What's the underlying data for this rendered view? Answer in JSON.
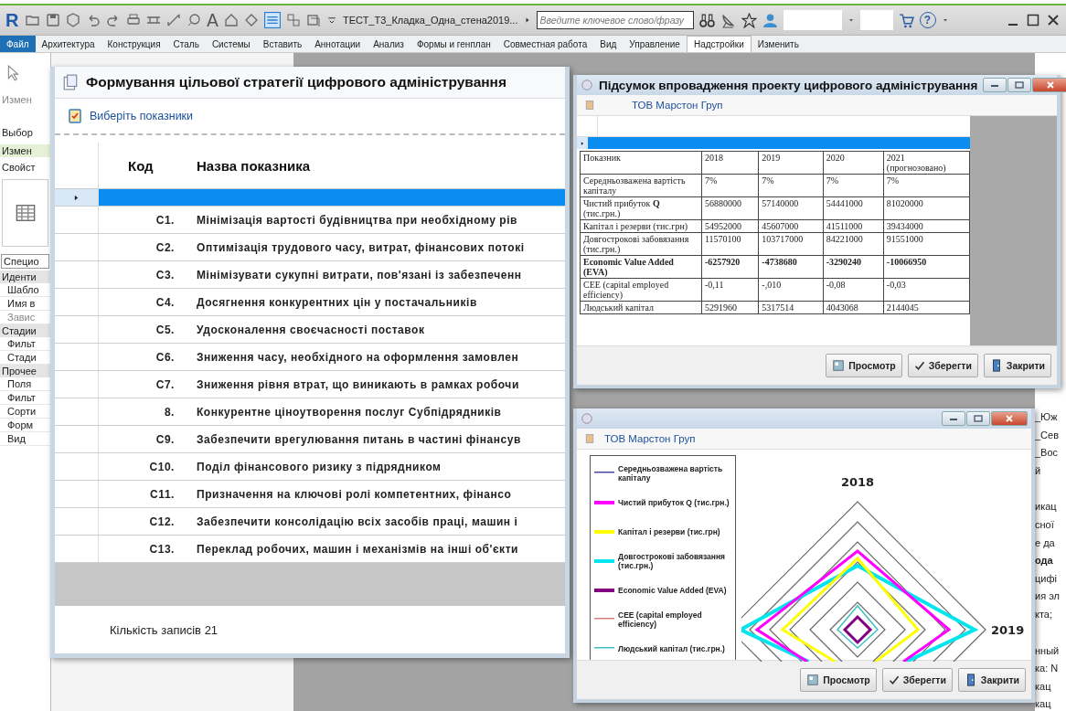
{
  "app": {
    "logo": "R",
    "text_tool": "A",
    "document_title": "ТЕСТ_Т3_Кладка_Одна_стена2019...",
    "search": {
      "placeholder": "Введите ключевое слово/фразу"
    },
    "help": "?"
  },
  "ribbon_tabs": [
    {
      "label": "Файл",
      "kind": "app_menu",
      "selected": false
    },
    {
      "label": "Архитектура",
      "kind": "tab",
      "selected": false
    },
    {
      "label": "Конструкция",
      "kind": "tab",
      "selected": false
    },
    {
      "label": "Сталь",
      "kind": "tab",
      "selected": false
    },
    {
      "label": "Системы",
      "kind": "tab",
      "selected": false
    },
    {
      "label": "Вставить",
      "kind": "tab",
      "selected": false
    },
    {
      "label": "Аннотации",
      "kind": "tab",
      "selected": false
    },
    {
      "label": "Анализ",
      "kind": "tab",
      "selected": false
    },
    {
      "label": "Формы и генплан",
      "kind": "tab",
      "selected": false
    },
    {
      "label": "Совместная работа",
      "kind": "tab",
      "selected": false
    },
    {
      "label": "Вид",
      "kind": "tab",
      "selected": false
    },
    {
      "label": "Управление",
      "kind": "tab",
      "selected": false
    },
    {
      "label": "Надстройки",
      "kind": "tab",
      "selected": true
    },
    {
      "label": "Изменить",
      "kind": "tab",
      "selected": false
    }
  ],
  "left_panel": {
    "modify_label": "Измен",
    "select_label": "Выбор",
    "context_label": "Измен",
    "properties_label": "Свойст",
    "type_selector": "Специо",
    "groups": [
      {
        "title": "Иденти",
        "params": [
          {
            "label": "Шабло",
            "disabled": false
          },
          {
            "label": "Имя в",
            "disabled": false
          },
          {
            "label": "Завис",
            "disabled": true
          }
        ]
      },
      {
        "title": "Стадии",
        "params": [
          {
            "label": "Фильт",
            "disabled": false
          },
          {
            "label": "Стади",
            "disabled": false
          }
        ]
      },
      {
        "title": "Прочее",
        "params": [
          {
            "label": "Поля",
            "disabled": false
          },
          {
            "label": "Фильт",
            "disabled": false
          },
          {
            "label": "Сорти",
            "disabled": false
          },
          {
            "label": "Форм",
            "disabled": false
          },
          {
            "label": "Вид",
            "disabled": false
          }
        ]
      }
    ]
  },
  "right_panel_fragments": [
    {
      "lines": [
        {
          "text": "_Юж",
          "bold": false
        },
        {
          "text": "_Сев",
          "bold": false
        },
        {
          "text": "_Вос",
          "bold": false
        },
        {
          "text": "й",
          "bold": false
        }
      ]
    },
    {
      "lines": [
        {
          "text": "икац",
          "bold": false
        },
        {
          "text": "сної",
          "bold": false
        },
        {
          "text": "е да",
          "bold": false
        },
        {
          "text": "ода",
          "bold": true
        },
        {
          "text": "цифі",
          "bold": false
        },
        {
          "text": "ия эл",
          "bold": false
        },
        {
          "text": "кта;",
          "bold": false
        }
      ]
    },
    {
      "lines": [
        {
          "text": "нный",
          "bold": false
        },
        {
          "text": "ка: N",
          "bold": false
        },
        {
          "text": "кац",
          "bold": false
        },
        {
          "text": "кац",
          "bold": false
        }
      ]
    }
  ],
  "strategy_window": {
    "title": "Формування цільової стратегії цифрового адміністрування",
    "toolbar_button": "Виберіть показники",
    "columns": [
      "Код",
      "Назва показника"
    ],
    "rows": [
      {
        "selected": true
      },
      {
        "code": "C1.",
        "name": "Мінімізація вартості будівництва при необхідному рів",
        "selected": false
      },
      {
        "code": "C2.",
        "name": "Оптимізація трудового часу, витрат, фінансових потокі",
        "selected": false
      },
      {
        "code": "C3.",
        "name": "Мінімізувати сукупні витрати, пов'язані із забезпеченн",
        "selected": false
      },
      {
        "code": "C4.",
        "name": "Досягнення конкурентних цін у постачальників",
        "selected": false
      },
      {
        "code": "C5.",
        "name": "Удосконалення своєчасності поставок",
        "selected": false
      },
      {
        "code": "C6.",
        "name": "Зниження часу, необхідного на оформлення замовлен",
        "selected": false
      },
      {
        "code": "C7.",
        "name": "Зниження рівня втрат, що виникають в рамках робочи",
        "selected": false
      },
      {
        "code": "8.",
        "name": "Конкурентне ціноутворення послуг Субпідрядників",
        "selected": false
      },
      {
        "code": "C9.",
        "name": "Забезпечити врегулювання питань в частині фінансув",
        "selected": false
      },
      {
        "code": "C10.",
        "name": "Поділ фінансового ризику з підрядником",
        "selected": false
      },
      {
        "code": "C11.",
        "name": "Призначення на ключові ролі компетентних, фінансо",
        "selected": false
      },
      {
        "code": "C12.",
        "name": "Забезпечити консолідацію всіх засобів праці, машин і",
        "selected": false
      },
      {
        "code": "C13.",
        "name": "Переклад робочих, машин і механізмів на інші об'єкти",
        "selected": false
      }
    ],
    "record_count": "Кількість записів 21"
  },
  "summary_window": {
    "title": "Підсумок впровадження проекту цифрового адміністрування",
    "company": "ТОВ Марстон Груп",
    "columns": [
      "Показник",
      "2018",
      "2019",
      "2020",
      "2021 (прогнозовано)"
    ],
    "rows": [
      {
        "bold": false,
        "cells": [
          "Середньозважена вартість капіталу",
          "7%",
          "7%",
          "7%",
          "7%"
        ]
      },
      {
        "bold": false,
        "cells": [
          "Чистий прибуток **Q** (тис.грн.)",
          "56880000",
          "57140000",
          "54441000",
          "81020000"
        ]
      },
      {
        "bold": false,
        "cells": [
          "Капітал і резерви (тис.грн)",
          "54952000",
          "45607000",
          "41511000",
          "39434000"
        ]
      },
      {
        "bold": false,
        "cells": [
          "Довгострокові забовязання (тис.грн.)",
          "11570100",
          "103717000",
          "84221000",
          "91551000"
        ]
      },
      {
        "bold": true,
        "cells": [
          "Economic Value Added (EVA)",
          "-6257920",
          "-4738680",
          "-3290240",
          "-10066950"
        ]
      },
      {
        "bold": false,
        "cells": [
          "CEE (capital employed efficiency)",
          "-0,11",
          "-,010",
          "-0,08",
          "-0,03"
        ]
      },
      {
        "bold": false,
        "cells": [
          "Людський капітал",
          "5291960",
          "5317514",
          "4043068",
          "2144045"
        ]
      }
    ],
    "buttons": [
      {
        "label": "Просмотр",
        "kind": "preview"
      },
      {
        "label": "Зберегти",
        "kind": "save"
      },
      {
        "label": "Закрити",
        "kind": "close"
      }
    ]
  },
  "chart_window": {
    "company": "ТОВ Марстон Груп",
    "legend": [
      {
        "label": "Середньозважена вартість капіталу",
        "color": "#4a4a9a"
      },
      {
        "label": "Чистий прибуток Q (тис.грн.)",
        "color": "#ff00ff"
      },
      {
        "label": "Капітал і резерви (тис.грн)",
        "color": "#ffff00"
      },
      {
        "label": "Довгострокові забовязання (тис.грн.)",
        "color": "#00e5ee"
      },
      {
        "label": "Economic Value Added (EVA)",
        "color": "#800080"
      },
      {
        "label": "CEE (capital employed efficiency)",
        "color": "#d08080"
      },
      {
        "label": "Людський капітал (тис.грн.)",
        "color": "#40c0c0"
      }
    ],
    "axis_labels": [
      "2018",
      "2019"
    ],
    "buttons": [
      {
        "label": "Просмотр",
        "kind": "preview"
      },
      {
        "label": "Зберегти",
        "kind": "save"
      },
      {
        "label": "Закрити",
        "kind": "close"
      }
    ]
  }
}
